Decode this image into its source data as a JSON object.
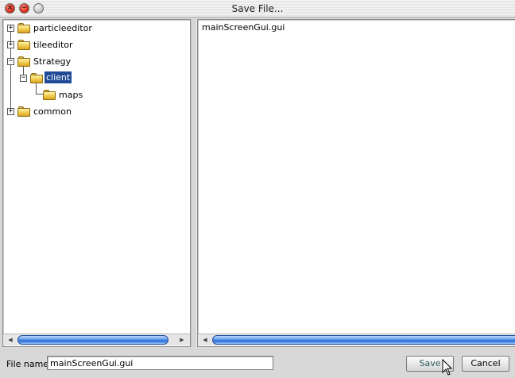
{
  "window": {
    "title": "Save File..."
  },
  "tree": {
    "nodes": [
      {
        "label": "particleeditor",
        "expander": "+",
        "selected": false
      },
      {
        "label": "tileeditor",
        "expander": "+",
        "selected": false
      },
      {
        "label": "Strategy",
        "expander": "−",
        "selected": false
      },
      {
        "label": "client",
        "expander": "−",
        "selected": true
      },
      {
        "label": "maps",
        "expander": "",
        "selected": false
      },
      {
        "label": "common",
        "expander": "+",
        "selected": false
      }
    ]
  },
  "files": {
    "items": [
      "mainScreenGui.gui"
    ]
  },
  "bottom": {
    "file_name_label": "File name:",
    "file_name_value": "mainScreenGui.gui",
    "save_label": "Save",
    "cancel_label": "Cancel"
  },
  "colors": {
    "selection": "#1f4a96",
    "scroll_thumb": "#2a6ed6",
    "close_button": "#e0321e"
  },
  "icons": {
    "close": "close-icon",
    "minimize": "minimize-icon",
    "maximize": "maximize-icon",
    "folder": "folder-icon",
    "scroll_left": "arrow-left-icon",
    "scroll_right": "arrow-right-icon",
    "cursor": "mouse-cursor-icon"
  }
}
